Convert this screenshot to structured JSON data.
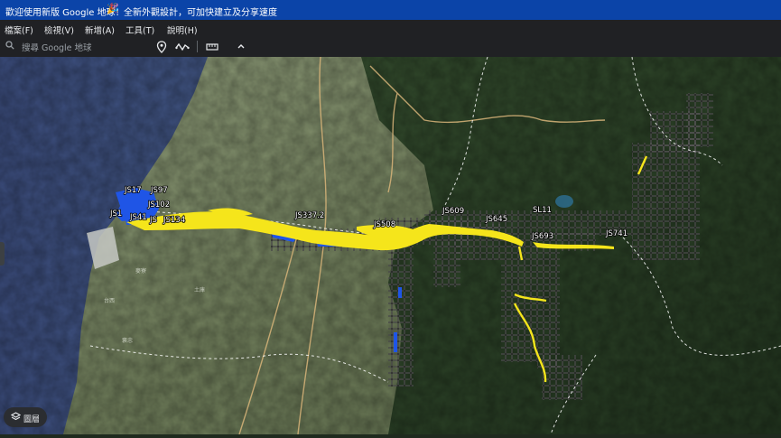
{
  "banner": {
    "welcome": "歡迎使用新版 Google 地球！",
    "party_icon": "party-popper-icon",
    "feature_text": "全新外觀設計，可加快建立及分享速度"
  },
  "menu": {
    "file": "檔案(F)",
    "view": "檢視(V)",
    "add": "新增(A)",
    "tools": "工具(T)",
    "help": "說明(H)"
  },
  "search": {
    "placeholder": "搜尋 Google 地球",
    "icon": "search-icon"
  },
  "toolbar": {
    "placemark_icon": "placemark-icon",
    "path_icon": "path-icon",
    "ruler_icon": "ruler-icon",
    "collapse_icon": "chevron-up-icon"
  },
  "map": {
    "labels": [
      "JS17",
      "JS97",
      "JS102",
      "JS1",
      "JS41",
      "JS",
      "JS134",
      "JS337.2",
      "JS508",
      "JS609",
      "JS645",
      "SL11",
      "JS693",
      "JS741"
    ],
    "towns": [
      "麥寮",
      "台西",
      "褒忠",
      "土庫"
    ],
    "colors": {
      "river_highlight": "#f5e51b",
      "water_overlay": "#1f55e6",
      "grid_overlay": "#2a2a2a",
      "road": "#d9b57a",
      "boundary": "#ffffff"
    }
  },
  "layers_button": {
    "label": "圖層",
    "icon": "layers-icon"
  }
}
